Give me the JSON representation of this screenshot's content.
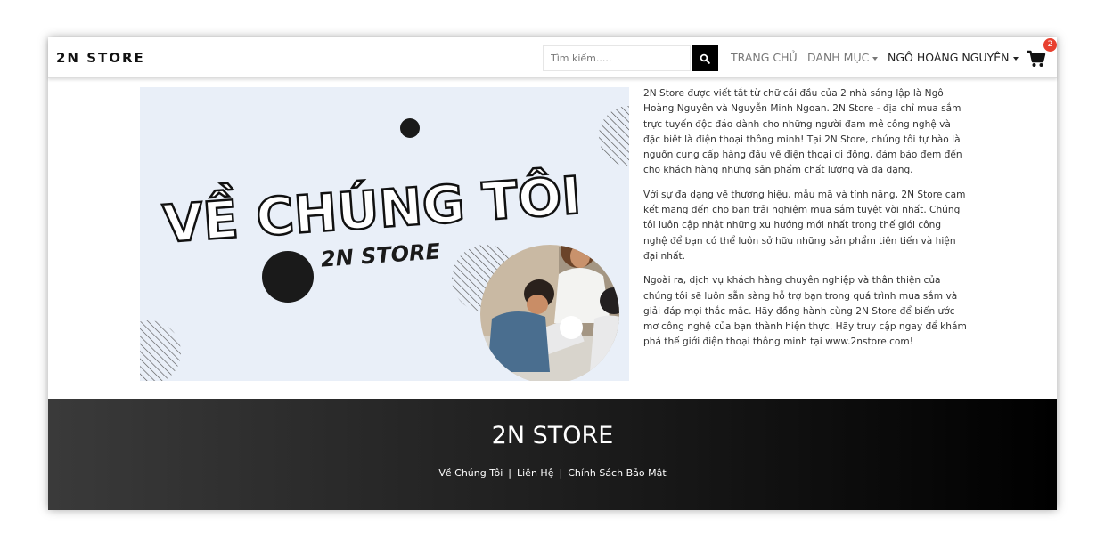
{
  "nav": {
    "brand": "2N STORE",
    "search_placeholder": "Tìm kiếm.....",
    "home": "TRANG CHỦ",
    "category": "DANH MỤC",
    "user": "NGÔ HOÀNG NGUYÊN",
    "cart_count": "2"
  },
  "hero": {
    "title": "VỀ CHÚNG TÔI",
    "subtitle": "2N STORE"
  },
  "about": {
    "paragraphs": [
      "2N Store được viết tắt từ chữ cái đầu của 2 nhà sáng lập là Ngô Hoàng Nguyên và Nguyễn Minh Ngoan. 2N Store - địa chỉ mua sắm trực tuyến độc đáo dành cho những người đam mê công nghệ và đặc biệt là điện thoại thông minh! Tại 2N Store, chúng tôi tự hào là nguồn cung cấp hàng đầu về điện thoại di động, đảm bảo đem đến cho khách hàng những sản phẩm chất lượng và đa dạng.",
      "Với sự đa dạng về thương hiệu, mẫu mã và tính năng, 2N Store cam kết mang đến cho bạn trải nghiệm mua sắm tuyệt vời nhất. Chúng tôi luôn cập nhật những xu hướng mới nhất trong thế giới công nghệ để bạn có thể luôn sở hữu những sản phẩm tiên tiến và hiện đại nhất.",
      "Ngoài ra, dịch vụ khách hàng chuyên nghiệp và thân thiện của chúng tôi sẽ luôn sẵn sàng hỗ trợ bạn trong quá trình mua sắm và giải đáp mọi thắc mắc. Hãy đồng hành cùng 2N Store để biến ước mơ công nghệ của bạn thành hiện thực. Hãy truy cập ngay để khám phá thế giới điện thoại thông minh tại www.2nstore.com!"
    ]
  },
  "footer": {
    "title": "2N STORE",
    "links": [
      "Về Chúng Tôi",
      "Liên Hệ",
      "Chính Sách Bảo Mật"
    ],
    "separator": "|"
  }
}
